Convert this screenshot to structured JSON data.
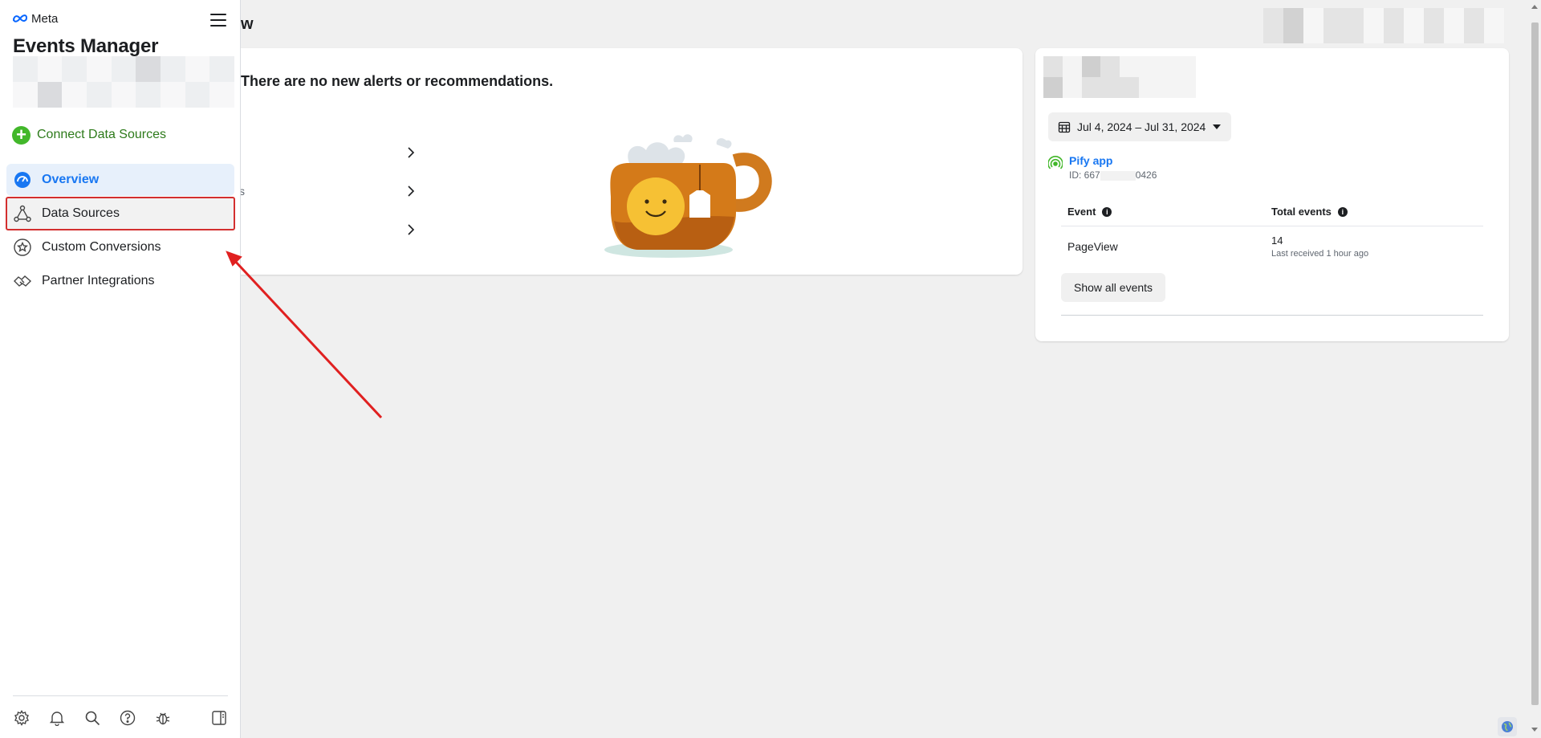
{
  "sidebar": {
    "brand": "Meta",
    "title": "Events Manager",
    "connect_label": "Connect Data Sources",
    "items": [
      {
        "label": "Overview"
      },
      {
        "label": "Data Sources"
      },
      {
        "label": "Custom Conversions"
      },
      {
        "label": "Partner Integrations"
      }
    ]
  },
  "header": {
    "title_fragment": "w"
  },
  "alerts": {
    "message": "There are no new alerts or recommendations.",
    "row_fragments": [
      "",
      "s",
      ""
    ]
  },
  "side_panel": {
    "date_range": "Jul 4, 2024 – Jul 31, 2024",
    "pixel_name": "Pify app",
    "pixel_id_prefix": "ID: 667",
    "pixel_id_suffix": "0426",
    "table": {
      "col_event": "Event",
      "col_total": "Total events",
      "rows": [
        {
          "event": "PageView",
          "count": "14",
          "last_received": "Last received 1 hour ago"
        }
      ]
    },
    "show_all_label": "Show all events"
  },
  "colors": {
    "accent": "#1877f2",
    "connect_green": "#42b72a",
    "highlight_red": "#d32f2f"
  },
  "icons": {
    "hamburger": "menu-icon",
    "overview": "dashboard-gauge-icon",
    "data_sources": "network-nodes-icon",
    "custom_conversions": "star-badge-icon",
    "partner_integrations": "handshake-icon",
    "footer": [
      "gear-icon",
      "bell-icon",
      "search-icon",
      "help-icon",
      "bug-icon",
      "panel-toggle-icon"
    ]
  }
}
